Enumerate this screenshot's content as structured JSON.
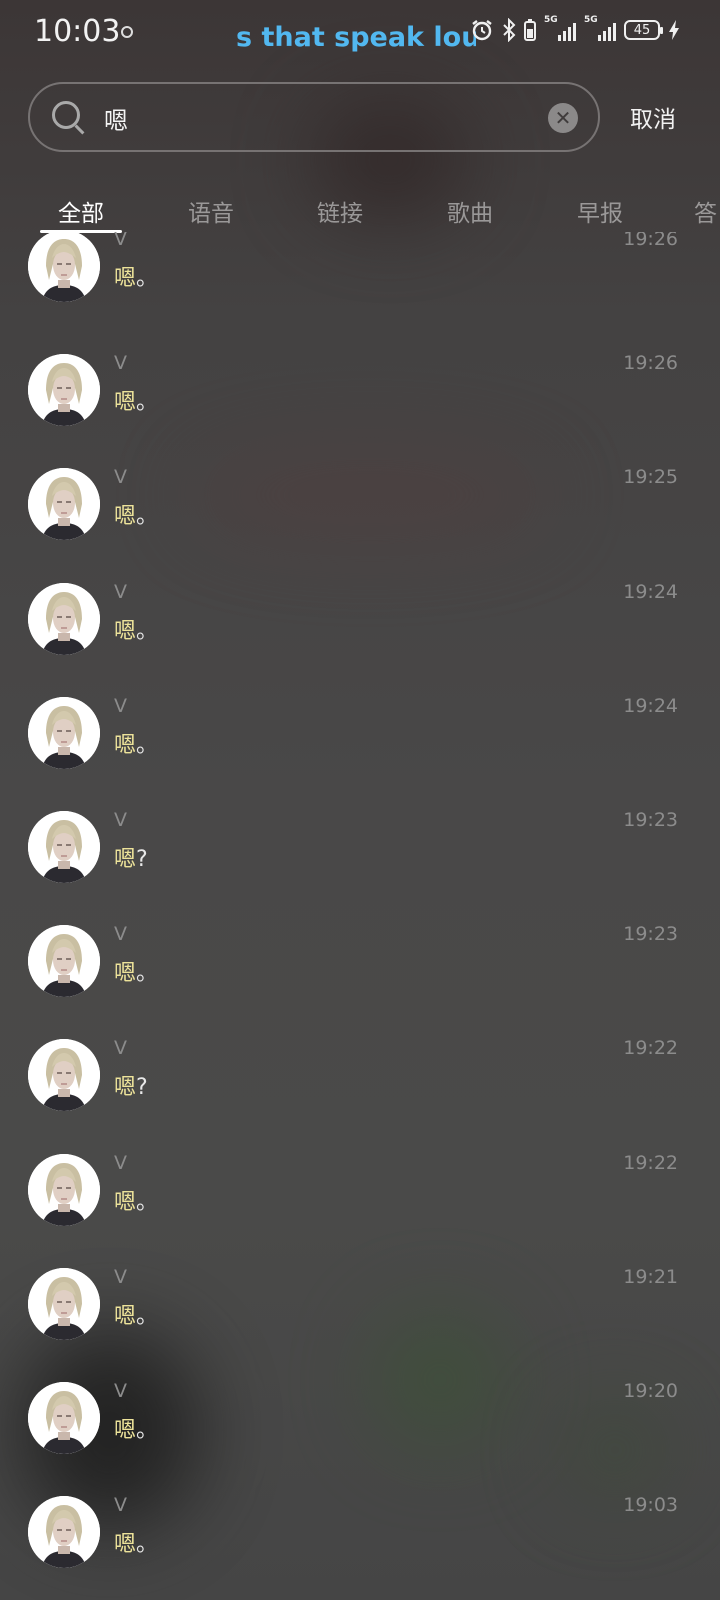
{
  "status_bar": {
    "time": "10:03",
    "ticker": "s that speak louder",
    "network_1": "5G",
    "network_2": "5G",
    "battery": "45"
  },
  "search": {
    "query": "嗯",
    "cancel_label": "取消"
  },
  "tabs": [
    "全部",
    "语音",
    "链接",
    "歌曲",
    "早报",
    "答"
  ],
  "active_tab": 0,
  "results": [
    {
      "sender": "V",
      "time": "19:26",
      "highlight": "嗯",
      "rest": "。"
    },
    {
      "sender": "V",
      "time": "19:26",
      "highlight": "嗯",
      "rest": "。"
    },
    {
      "sender": "V",
      "time": "19:25",
      "highlight": "嗯",
      "rest": "。"
    },
    {
      "sender": "V",
      "time": "19:24",
      "highlight": "嗯",
      "rest": "。"
    },
    {
      "sender": "V",
      "time": "19:24",
      "highlight": "嗯",
      "rest": "。"
    },
    {
      "sender": "V",
      "time": "19:23",
      "highlight": "嗯",
      "rest": "?"
    },
    {
      "sender": "V",
      "time": "19:23",
      "highlight": "嗯",
      "rest": "。"
    },
    {
      "sender": "V",
      "time": "19:22",
      "highlight": "嗯",
      "rest": "?"
    },
    {
      "sender": "V",
      "time": "19:22",
      "highlight": "嗯",
      "rest": "。"
    },
    {
      "sender": "V",
      "time": "19:21",
      "highlight": "嗯",
      "rest": "。"
    },
    {
      "sender": "V",
      "time": "19:20",
      "highlight": "嗯",
      "rest": "。"
    },
    {
      "sender": "V",
      "time": "19:03",
      "highlight": "嗯",
      "rest": "。"
    }
  ]
}
